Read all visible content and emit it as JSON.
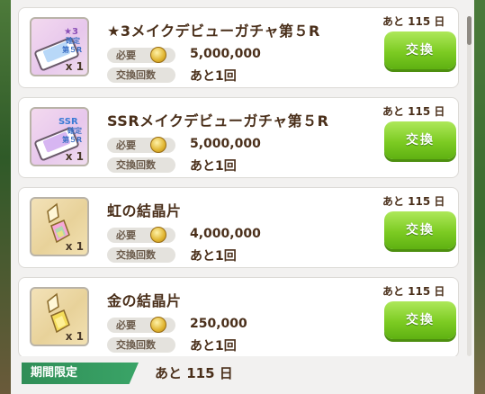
{
  "items": [
    {
      "name": "★3メイクデビューガチャ第５R",
      "thumb_type": "ticket",
      "thumb_text": [
        "★3",
        "確定",
        "第５R"
      ],
      "qty": "x 1",
      "required_label": "必要",
      "required_value": "5,000,000",
      "exchange_label": "交換回数",
      "exchange_value": "あと1回",
      "remaining": "あと 115 日",
      "button": "交換"
    },
    {
      "name": "SSRメイクデビューガチャ第５R",
      "thumb_type": "ticket",
      "thumb_text": [
        "SSR",
        "確定",
        "第５R"
      ],
      "qty": "x 1",
      "required_label": "必要",
      "required_value": "5,000,000",
      "exchange_label": "交換回数",
      "exchange_value": "あと1回",
      "remaining": "あと 115 日",
      "button": "交換"
    },
    {
      "name": "虹の結晶片",
      "thumb_type": "gold",
      "thumb_text": [],
      "qty": "x 1",
      "required_label": "必要",
      "required_value": "4,000,000",
      "exchange_label": "交換回数",
      "exchange_value": "あと1回",
      "remaining": "あと 115 日",
      "button": "交換"
    },
    {
      "name": "金の結晶片",
      "thumb_type": "gold",
      "thumb_text": [],
      "qty": "x 1",
      "required_label": "必要",
      "required_value": "250,000",
      "exchange_label": "交換回数",
      "exchange_value": "あと1回",
      "remaining": "あと 115 日",
      "button": "交換"
    }
  ],
  "footer": {
    "limited_label": "期間限定",
    "remaining": "あと 115 日"
  },
  "colors": {
    "button_green": "#7ccb22",
    "badge_green": "#2f8e57",
    "text_brown": "#4a2f1a"
  }
}
